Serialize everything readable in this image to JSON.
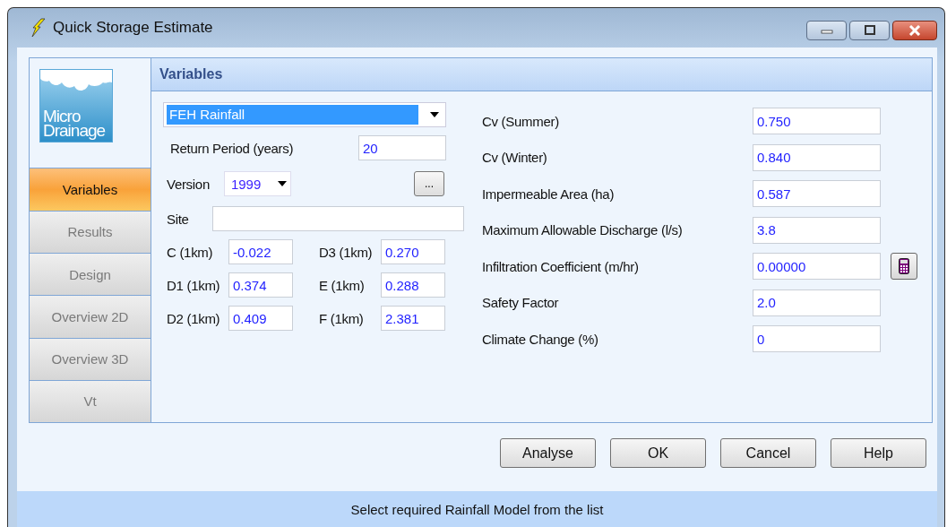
{
  "window": {
    "title": "Quick Storage Estimate"
  },
  "logo": {
    "line1": "Micro",
    "line2": "Drainage"
  },
  "nav": [
    {
      "label": "Variables",
      "selected": true,
      "disabled": false
    },
    {
      "label": "Results",
      "selected": false,
      "disabled": true
    },
    {
      "label": "Design",
      "selected": false,
      "disabled": true
    },
    {
      "label": "Overview 2D",
      "selected": false,
      "disabled": true
    },
    {
      "label": "Overview 3D",
      "selected": false,
      "disabled": true
    },
    {
      "label": "Vt",
      "selected": false,
      "disabled": true
    }
  ],
  "panel": {
    "title": "Variables"
  },
  "rainfall_model": {
    "value": "FEH Rainfall",
    "highlighted": true
  },
  "return_period": {
    "label": "Return Period (years)",
    "value": "20"
  },
  "version": {
    "label": "Version",
    "value": "1999"
  },
  "browse_button": "...",
  "site": {
    "label": "Site"
  },
  "coefficients": [
    {
      "label": "C (1km)",
      "value": "-0.022"
    },
    {
      "label": "D3 (1km)",
      "value": "0.270"
    },
    {
      "label": "D1 (1km)",
      "value": "0.374"
    },
    {
      "label": "E (1km)",
      "value": "0.288"
    },
    {
      "label": "D2 (1km)",
      "value": "0.409"
    },
    {
      "label": "F (1km)",
      "value": "2.381"
    }
  ],
  "parameters": [
    {
      "label": "Cv (Summer)",
      "value": "0.750",
      "kind": "plain"
    },
    {
      "label": "Cv (Winter)",
      "value": "0.840",
      "kind": "plain"
    },
    {
      "label": "Impermeable Area (ha)",
      "value": "0.587",
      "kind": "plain"
    },
    {
      "label": "Maximum Allowable Discharge (l/s)",
      "value": "3.8",
      "kind": "plain"
    },
    {
      "label": "Infiltration Coefficient (m/hr)",
      "value": "0.00000",
      "kind": "calculator"
    },
    {
      "label": "Safety Factor",
      "value": "2.0",
      "kind": "plain"
    },
    {
      "label": "Climate Change (%)",
      "value": "0",
      "kind": "plain"
    }
  ],
  "buttons": [
    "Analyse",
    "OK",
    "Cancel",
    "Help"
  ],
  "status_bar": "Select required Rainfall Model from the list"
}
